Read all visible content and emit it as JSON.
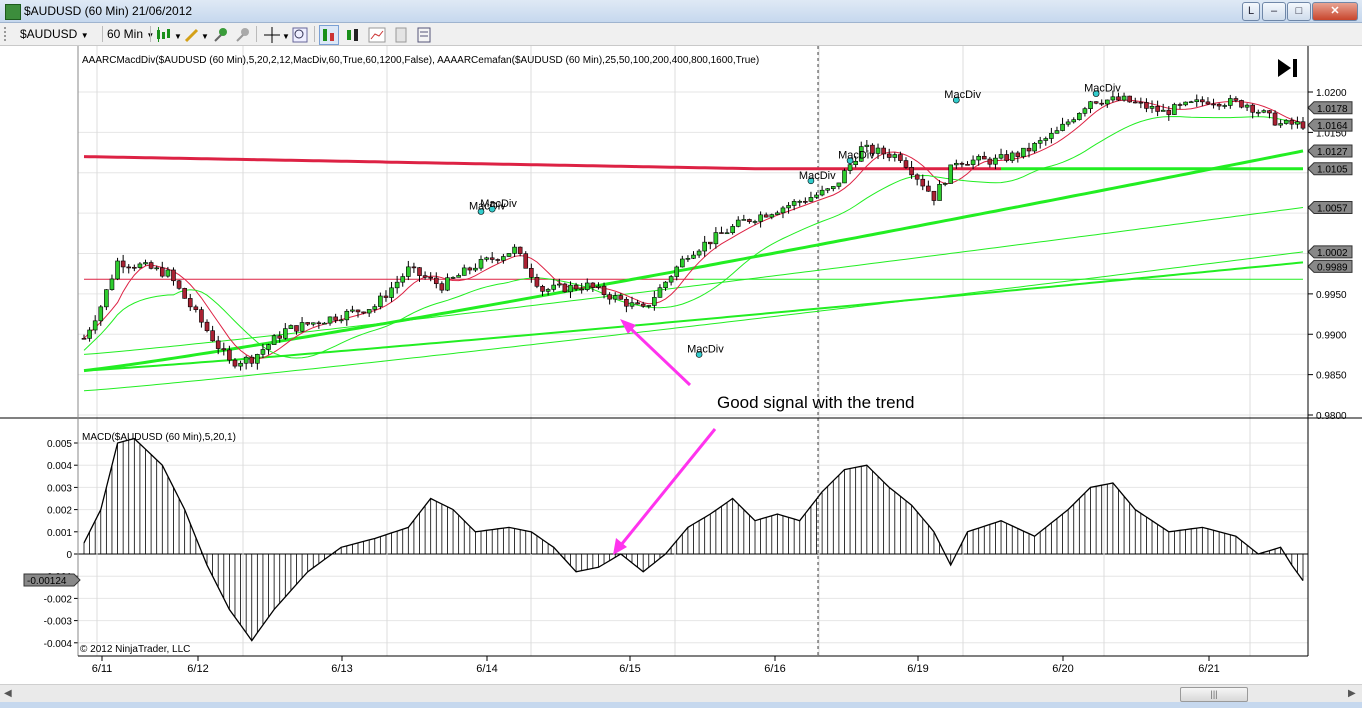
{
  "window": {
    "title": "$AUDUSD (60 Min)  21/06/2012",
    "buttons": {
      "l": "L",
      "min": "–",
      "max": "□",
      "close": "✕"
    }
  },
  "toolbar": {
    "instrument": "$AUDUSD",
    "interval": "60 Min",
    "icons": [
      "grip",
      "candlestick-icon",
      "pencil-icon",
      "pin-icon",
      "pin2-icon",
      "crosshair-icon",
      "zoom-icon",
      "bar-chart-icon",
      "candles-icon",
      "line-icon",
      "properties-icon",
      "data-box-icon"
    ]
  },
  "price_panel": {
    "indicator_label": "AAARCMacdDiv($AUDUSD (60 Min),5,20,2,12,MacDiv,60,True,60,1200,False), AAAARCemafan($AUDUSD (60 Min),25,50,100,200,400,800,1600,True)",
    "annotation": "Good signal with the trend",
    "signal_label": "MacDiv",
    "price_boxes": [
      "1.0178",
      "1.0164",
      "1.0127",
      "1.0105",
      "1.0057",
      "1.0002",
      "0.9989"
    ],
    "y_ticks": [
      "1.0200",
      "1.0150",
      "0.9950",
      "0.9900",
      "0.9850",
      "0.9800"
    ]
  },
  "macd_panel": {
    "label": "MACD($AUDUSD (60 Min),5,20,1)",
    "current_box": "-0.00124",
    "y_ticks": [
      "0.005",
      "0.004",
      "0.003",
      "0.002",
      "0.001",
      "0",
      "-0.001",
      "-0.002",
      "-0.003",
      "-0.004"
    ],
    "copyright": "© 2012 NinjaTrader, LLC"
  },
  "x_ticks": [
    "6/11",
    "6/12",
    "6/13",
    "6/14",
    "6/15",
    "6/16",
    "6/19",
    "6/20",
    "6/21"
  ],
  "colors": {
    "ema_green": "#22ee22",
    "ema_red": "#dd2244",
    "signal_dot": "#33cccc",
    "arrow": "#ff33ee",
    "candle_down": "#aa2233"
  },
  "chart_data": {
    "type": "candlestick",
    "price_range": [
      0.978,
      1.0225
    ],
    "macd_range": [
      -0.0045,
      0.0055
    ],
    "x_dates": [
      "6/11",
      "6/12",
      "6/13",
      "6/14",
      "6/15",
      "6/16",
      "6/19",
      "6/20",
      "6/21"
    ],
    "ema_fan_final_values": [
      1.0178,
      1.0164,
      1.0127,
      1.0105,
      1.0057,
      1.0002,
      0.9989
    ],
    "price_anchors": [
      [
        0,
        0.9895
      ],
      [
        3,
        0.9935
      ],
      [
        6,
        0.999
      ],
      [
        10,
        0.9985
      ],
      [
        15,
        0.9975
      ],
      [
        18,
        0.9945
      ],
      [
        22,
        0.9905
      ],
      [
        26,
        0.9865
      ],
      [
        30,
        0.987
      ],
      [
        36,
        0.9905
      ],
      [
        44,
        0.992
      ],
      [
        52,
        0.9935
      ],
      [
        58,
        0.998
      ],
      [
        64,
        0.996
      ],
      [
        70,
        0.9985
      ],
      [
        77,
        1.0005
      ],
      [
        82,
        0.9955
      ],
      [
        90,
        0.996
      ],
      [
        100,
        0.993
      ],
      [
        108,
        1.0
      ],
      [
        118,
        1.004
      ],
      [
        126,
        1.006
      ],
      [
        134,
        1.008
      ],
      [
        139,
        1.013
      ],
      [
        146,
        1.012
      ],
      [
        152,
        1.007
      ],
      [
        156,
        1.0115
      ],
      [
        163,
        1.0115
      ],
      [
        168,
        1.0125
      ],
      [
        174,
        1.015
      ],
      [
        180,
        1.019
      ],
      [
        186,
        1.019
      ],
      [
        193,
        1.0175
      ],
      [
        201,
        1.019
      ],
      [
        208,
        1.0185
      ],
      [
        214,
        1.016
      ],
      [
        218,
        1.016
      ]
    ],
    "macd_anchors": [
      [
        0,
        0.0005
      ],
      [
        3,
        0.002
      ],
      [
        6,
        0.005
      ],
      [
        9,
        0.0052
      ],
      [
        14,
        0.004
      ],
      [
        18,
        0.002
      ],
      [
        22,
        -0.0005
      ],
      [
        26,
        -0.0025
      ],
      [
        30,
        -0.0039
      ],
      [
        34,
        -0.0025
      ],
      [
        40,
        -0.0008
      ],
      [
        46,
        0.0003
      ],
      [
        52,
        0.0007
      ],
      [
        58,
        0.0012
      ],
      [
        62,
        0.0025
      ],
      [
        66,
        0.002
      ],
      [
        70,
        0.001
      ],
      [
        76,
        0.0012
      ],
      [
        80,
        0.001
      ],
      [
        84,
        0.0003
      ],
      [
        88,
        -0.0008
      ],
      [
        92,
        -0.0006
      ],
      [
        96,
        0.0
      ],
      [
        100,
        -0.0008
      ],
      [
        104,
        0.0
      ],
      [
        108,
        0.0012
      ],
      [
        112,
        0.0018
      ],
      [
        116,
        0.0025
      ],
      [
        120,
        0.0015
      ],
      [
        124,
        0.0018
      ],
      [
        128,
        0.0015
      ],
      [
        132,
        0.0028
      ],
      [
        136,
        0.0038
      ],
      [
        140,
        0.004
      ],
      [
        144,
        0.003
      ],
      [
        148,
        0.0022
      ],
      [
        152,
        0.001
      ],
      [
        155,
        -0.0005
      ],
      [
        158,
        0.001
      ],
      [
        164,
        0.0015
      ],
      [
        170,
        0.0008
      ],
      [
        176,
        0.002
      ],
      [
        180,
        0.003
      ],
      [
        184,
        0.0032
      ],
      [
        188,
        0.002
      ],
      [
        194,
        0.001
      ],
      [
        200,
        0.0012
      ],
      [
        206,
        0.0008
      ],
      [
        210,
        0.0
      ],
      [
        214,
        0.0003
      ],
      [
        216,
        -0.0005
      ],
      [
        218,
        -0.0012
      ]
    ],
    "ema_fan": [
      {
        "color": "red",
        "width": 3,
        "start": 1.012,
        "end": 1.0105
      },
      {
        "color": "red",
        "width": 1,
        "start": 0.9968,
        "end": 0.9968
      },
      {
        "color": "green",
        "width": 2,
        "start": 0.9855,
        "end": 0.9989
      },
      {
        "color": "green",
        "width": 3,
        "start": 0.9855,
        "end": 1.0127
      },
      {
        "color": "green",
        "width": 1,
        "start": 0.9875,
        "end": 1.0057
      },
      {
        "color": "green",
        "width": 1,
        "start": 0.983,
        "end": 1.0002
      }
    ],
    "signals": [
      {
        "bar": 71,
        "price": 1.0052,
        "label": "MacDiv"
      },
      {
        "bar": 73,
        "price": 1.0055,
        "label": "MacDiv"
      },
      {
        "bar": 110,
        "price": 0.9875,
        "label": "MacDiv"
      },
      {
        "bar": 130,
        "price": 1.009,
        "label": "MacDiv"
      },
      {
        "bar": 137,
        "price": 1.0115,
        "label": "MacDiv"
      },
      {
        "bar": 156,
        "price": 1.019,
        "label": "MacDiv"
      },
      {
        "bar": 181,
        "price": 1.0198,
        "label": "MacDiv"
      }
    ],
    "bar_count": 219
  }
}
